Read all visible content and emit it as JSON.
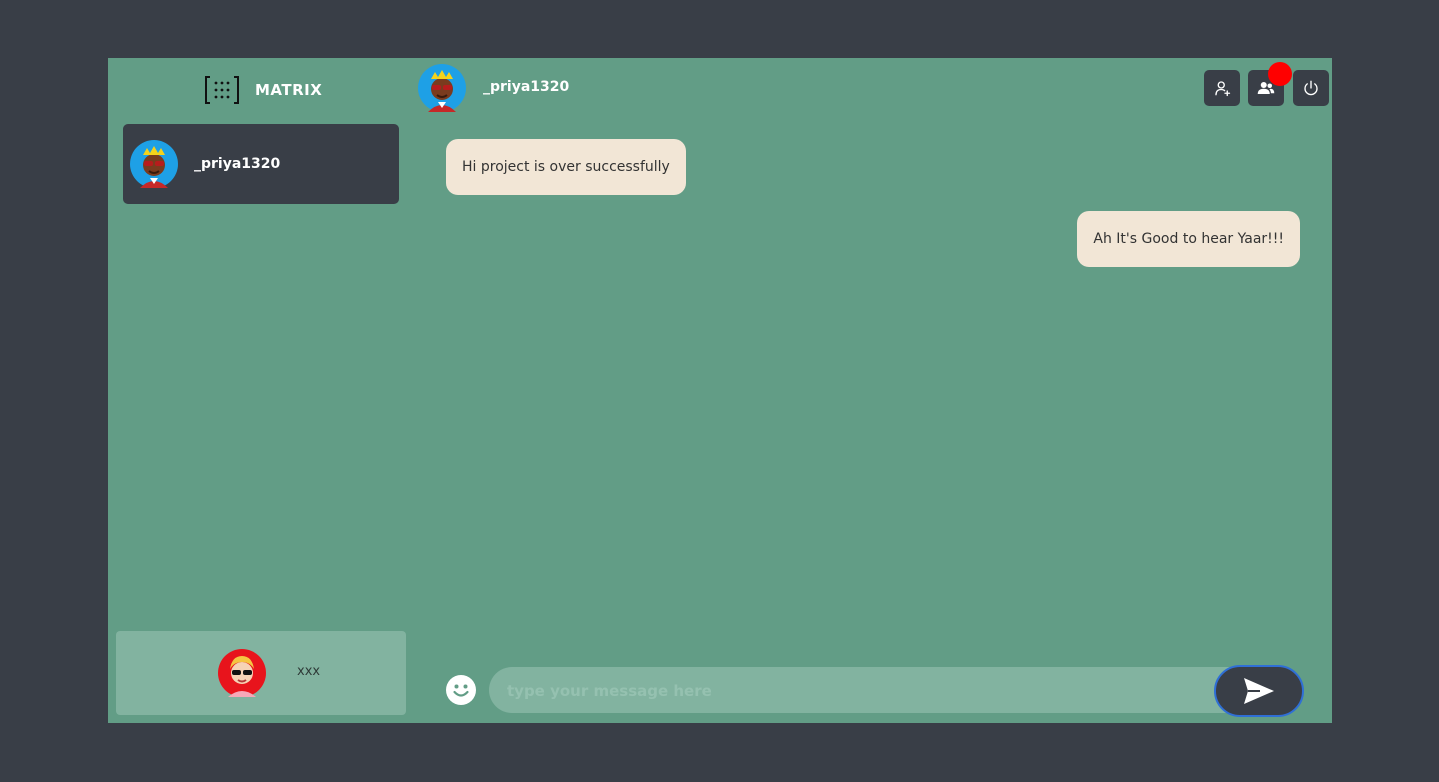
{
  "brand": {
    "name": "MATRIX",
    "logo_icon": "matrix-brackets-icon"
  },
  "contacts": [
    {
      "name": "_priya1320",
      "avatar_icon": "avatar-crown-sunglasses-icon",
      "selected": true
    }
  ],
  "current_user": {
    "name": "xxx",
    "avatar_icon": "avatar-blonde-sunglasses-icon"
  },
  "chat": {
    "header": {
      "name": "_priya1320",
      "avatar_icon": "avatar-crown-sunglasses-icon"
    },
    "messages": [
      {
        "direction": "incoming",
        "text": "Hi project is over successfully"
      },
      {
        "direction": "outgoing",
        "text": "Ah It's Good to hear Yaar!!!"
      }
    ],
    "composer": {
      "placeholder": "type your message here",
      "value": ""
    }
  },
  "header_actions": [
    {
      "name": "add-contact",
      "icon": "user-plus-icon"
    },
    {
      "name": "contacts",
      "icon": "users-icon",
      "has_notification": true
    },
    {
      "name": "logout",
      "icon": "power-icon"
    }
  ],
  "colors": {
    "background": "#393e47",
    "app_panel": "#629d86",
    "dark": "#393e47",
    "bubble": "#f2e6d6",
    "notification": "#ff0000",
    "send_border": "#2f6fd6"
  }
}
